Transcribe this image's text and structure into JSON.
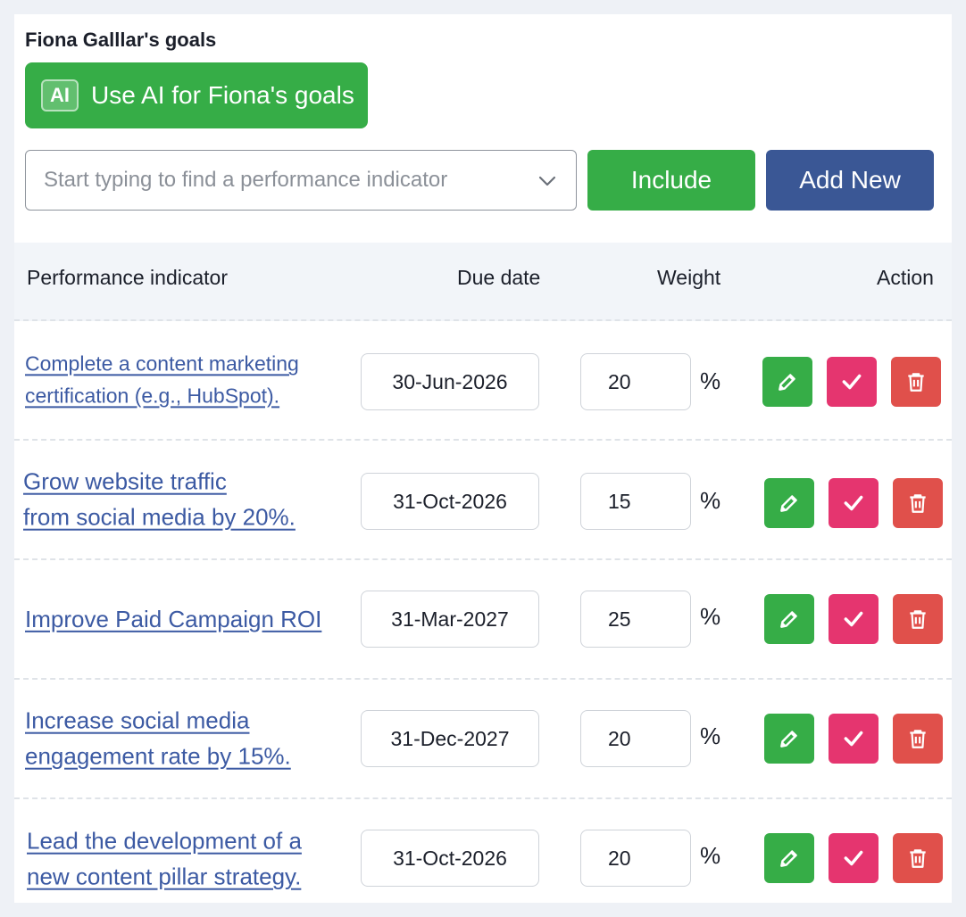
{
  "page": {
    "title": "Fiona Galllar's goals",
    "ai_badge": "AI",
    "ai_button_label": "Use AI for Fiona's goals"
  },
  "search": {
    "placeholder": "Start typing to find a performance indicator",
    "value": ""
  },
  "buttons": {
    "include": "Include",
    "add_new": "Add New"
  },
  "table": {
    "headers": {
      "indicator": "Performance indicator",
      "due_date": "Due date",
      "weight": "Weight",
      "action": "Action"
    },
    "percent_symbol": "%",
    "rows": [
      {
        "indicator": "Complete a content marketing\ncertification (e.g., HubSpot).",
        "due_date": "30-Jun-2026",
        "weight": "20"
      },
      {
        "indicator": "Grow website traffic\nfrom social media by 20%.",
        "due_date": "31-Oct-2026",
        "weight": "15"
      },
      {
        "indicator": "Improve Paid Campaign ROI",
        "due_date": "31-Mar-2027",
        "weight": "25"
      },
      {
        "indicator": "Increase social media\nengagement rate by 15%.",
        "due_date": "31-Dec-2027",
        "weight": "20"
      },
      {
        "indicator": "Lead the development of a\nnew content pillar strategy.",
        "due_date": "31-Oct-2026",
        "weight": "20"
      }
    ]
  },
  "colors": {
    "green": "#36ad47",
    "blue": "#3a5795",
    "pink": "#e5356f",
    "red": "#e0504b",
    "link": "#3c5aa3"
  },
  "icons": {
    "edit": "pencil-icon",
    "complete": "check-icon",
    "delete": "trash-icon",
    "dropdown": "chevron-down-icon"
  }
}
